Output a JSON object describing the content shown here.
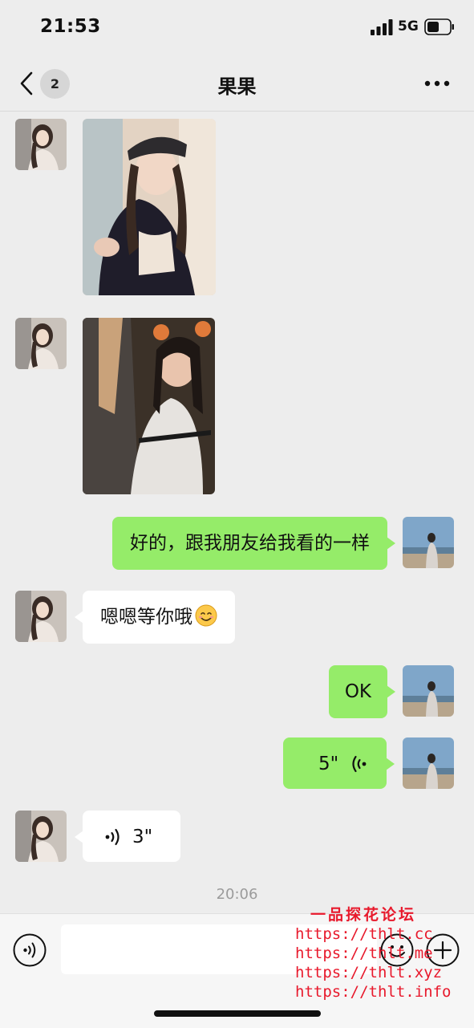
{
  "status_bar": {
    "time": "21:53",
    "network": "5G"
  },
  "nav": {
    "unread_count": "2",
    "title": "果果"
  },
  "messages": {
    "m3_text": "好的，跟我朋友给我看的一样",
    "m4_text": "嗯嗯等你哦",
    "m5_text": "OK",
    "m6_voice_duration": "5\"",
    "m7_voice_duration": "3\""
  },
  "timestamp": "20:06",
  "input": {
    "placeholder": ""
  },
  "watermark": {
    "title": "一品探花论坛",
    "lines": [
      "https://thlt.cc",
      "https://thlt.me",
      "https://thlt.xyz",
      "https://thlt.info"
    ]
  },
  "colors": {
    "background": "#ededed",
    "outgoing_bubble": "#95ec69",
    "incoming_bubble": "#ffffff",
    "watermark": "#e8192c"
  }
}
